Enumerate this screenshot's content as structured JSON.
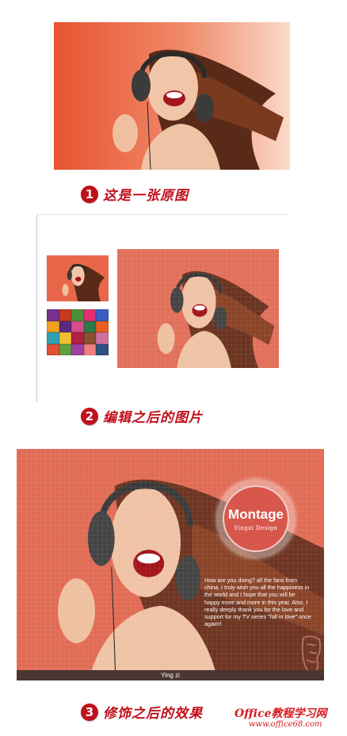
{
  "colors": {
    "accent_red": "#c0101b",
    "photo_orange": "#e8674a",
    "name_bar": "#4a3633"
  },
  "steps": [
    {
      "number": "1",
      "label": "这是一张原图"
    },
    {
      "number": "2",
      "label": "编辑之后的图片"
    },
    {
      "number": "3",
      "label": "修饰之后的效果"
    }
  ],
  "montage": {
    "title": "Montage",
    "subtitle": "Yingzi Design",
    "blurb": "How are you doing? all the fans from china, I truly wish you all the happiness in the world and I hope that you will be happy more and more in this year. Also, I really deeply thank you for the love and support for my TV series \"fall in love\" once again!!",
    "name": "Ying zi"
  },
  "watermark": {
    "line1": "Office教程学习网",
    "line2": "www.office68.com"
  }
}
